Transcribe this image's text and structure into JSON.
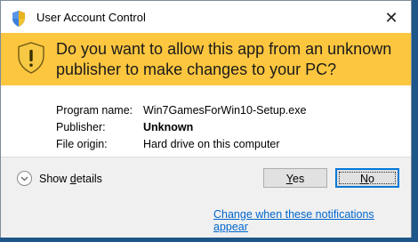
{
  "window": {
    "title": "User Account Control",
    "close_glyph": "✕"
  },
  "banner": {
    "question": "Do you want to allow this app from an unknown publisher to make changes to your PC?",
    "background": "#fdc63f"
  },
  "details": {
    "program_name_label": "Program name:",
    "program_name_value": "Win7GamesForWin10-Setup.exe",
    "publisher_label": "Publisher:",
    "publisher_value": "Unknown",
    "file_origin_label": "File origin:",
    "file_origin_value": "Hard drive on this computer"
  },
  "footer": {
    "show_details_prefix": "Show ",
    "show_details_accel": "d",
    "show_details_suffix": "etails",
    "yes_accel": "Y",
    "yes_rest": "es",
    "no_accel": "N",
    "no_rest": "o",
    "settings_link": "Change when these notifications appear"
  },
  "icons": {
    "title": "uac-shield-icon",
    "banner": "uac-shield-warning-icon",
    "expand": "chevron-down-icon"
  },
  "colors": {
    "link": "#0066cc",
    "focus": "#0078d7",
    "desktop": "#1b4f7e"
  }
}
